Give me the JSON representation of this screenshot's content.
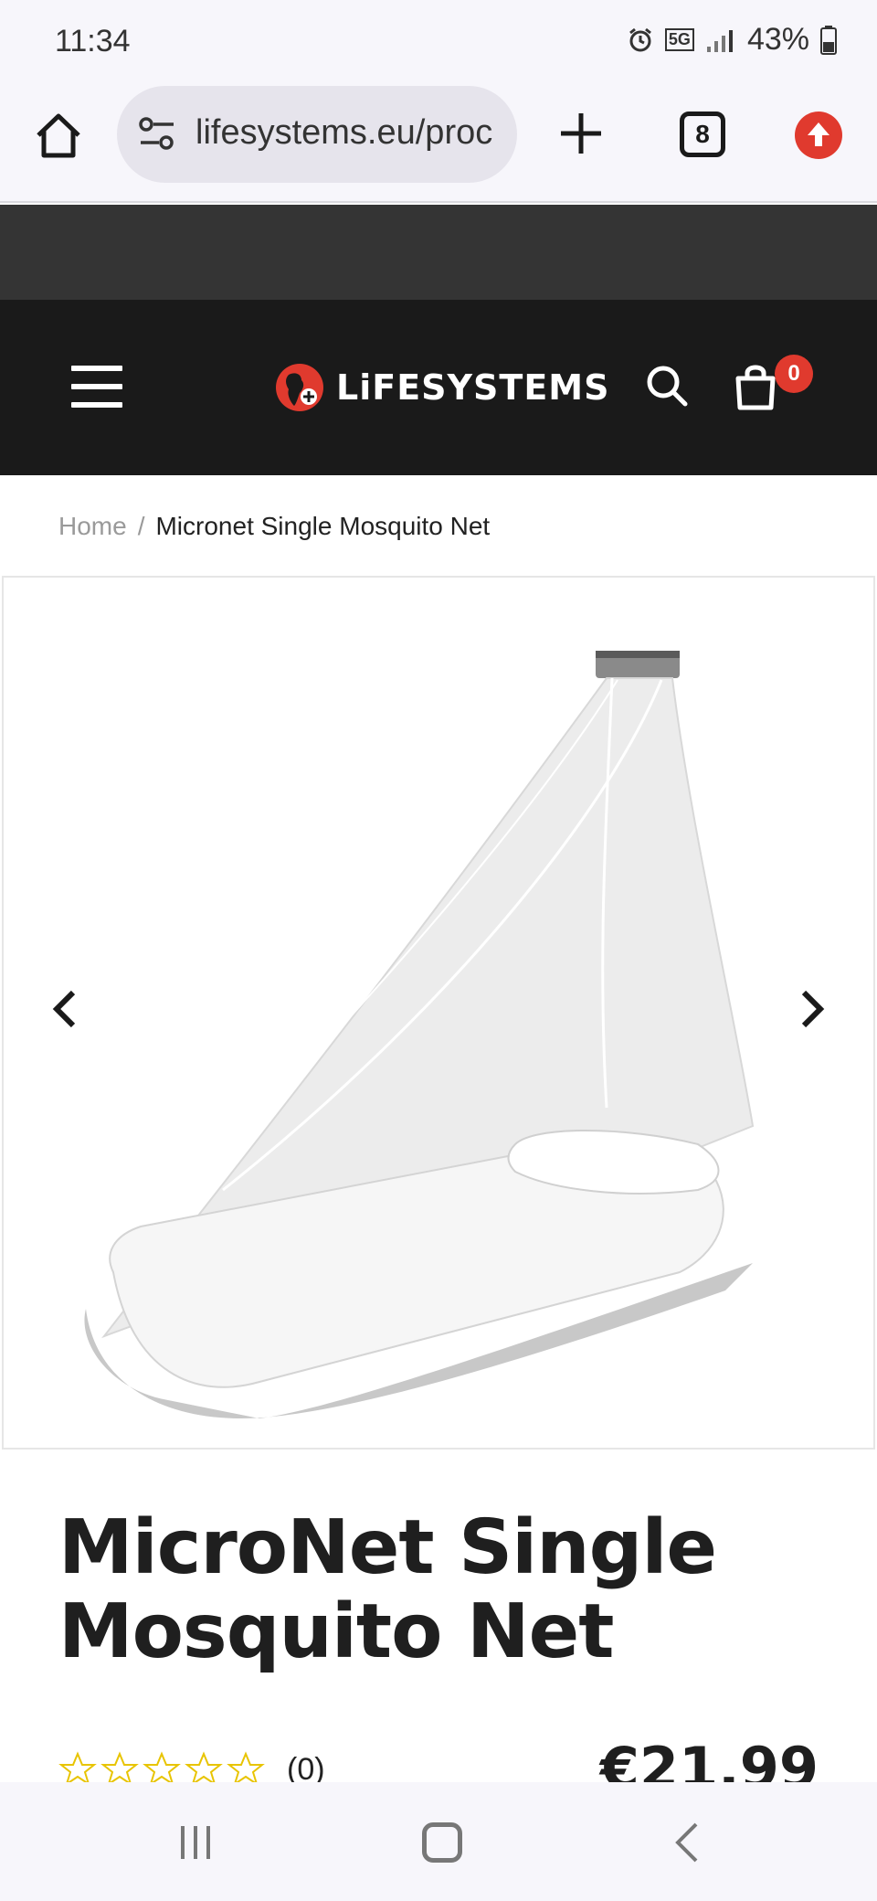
{
  "status_bar": {
    "time": "11:34",
    "network": "5G",
    "battery": "43%",
    "icons": [
      "alarm-icon",
      "network-5g-icon",
      "signal-icon",
      "battery-icon"
    ]
  },
  "browser": {
    "url": "lifesystems.eu/proc",
    "tab_count": "8",
    "icons": [
      "home-icon",
      "site-settings-icon",
      "plus-icon",
      "tabs-icon",
      "update-arrow-icon"
    ]
  },
  "header": {
    "logo_text": "LiFESYSTEMS",
    "cart_count": "0",
    "icons": [
      "hamburger-menu-icon",
      "search-icon",
      "shopping-bag-icon"
    ]
  },
  "breadcrumb": {
    "home": "Home",
    "separator": "/",
    "current": "Micronet Single Mosquito Net"
  },
  "product": {
    "title": "MicroNet Single Mosquito Net",
    "rating_stars": 0,
    "rating_max": 5,
    "rating_count": "(0)",
    "price": "€21.99"
  },
  "colors": {
    "accent": "#e03a2e",
    "header_bg": "#1a1a1a",
    "topstrip_bg": "#343434",
    "star_outline": "#e8c400"
  }
}
